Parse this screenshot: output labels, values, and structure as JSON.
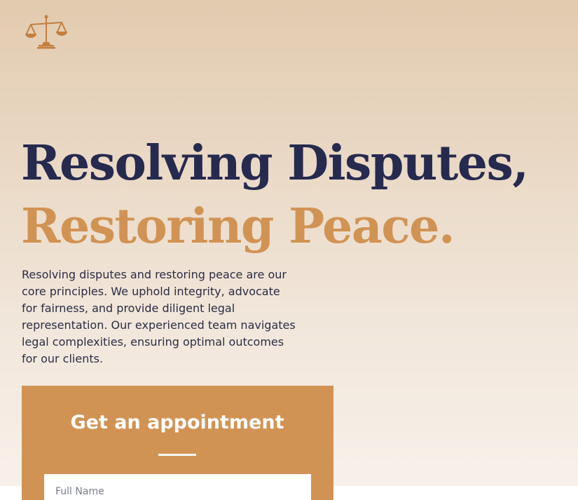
{
  "colors": {
    "navy": "#262a4f",
    "accent": "#d19354",
    "text": "#2b2d44",
    "background_top": "#e2cbaf",
    "background_bottom": "#f7f1ea"
  },
  "header": {
    "logo_icon": "scales-of-justice-icon"
  },
  "hero": {
    "headline_line1": "Resolving Disputes,",
    "headline_line2": "Restoring Peace.",
    "intro": "Resolving disputes and restoring peace are our core principles. We uphold integrity, advocate for fairness, and provide diligent legal representation. Our experienced team navigates legal complexities, ensuring optimal outcomes for our clients."
  },
  "appointment": {
    "title": "Get an appointment",
    "full_name_placeholder": "Full Name",
    "full_name_value": ""
  }
}
